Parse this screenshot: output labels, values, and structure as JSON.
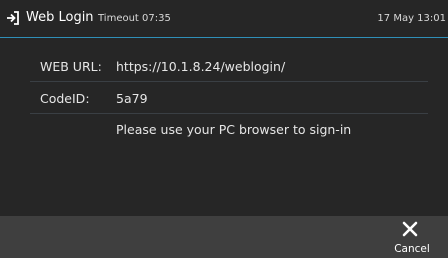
{
  "header": {
    "icon": "login-arrow-icon",
    "title": "Web Login",
    "timeout": "Timeout 07:35",
    "datetime": "17 May 13:01",
    "accent_color": "#2f8fb8"
  },
  "info": {
    "url_label": "WEB URL:",
    "url_value": "https://10.1.8.24/weblogin/",
    "code_label": "CodeID:",
    "code_value": "5a79",
    "message": "Please use your PC browser to sign-in"
  },
  "softkeys": {
    "cancel_icon": "close-icon",
    "cancel_label": "Cancel"
  },
  "colors": {
    "background": "#262626",
    "softkey_bar": "#3f3f3f",
    "text": "#ffffff"
  }
}
